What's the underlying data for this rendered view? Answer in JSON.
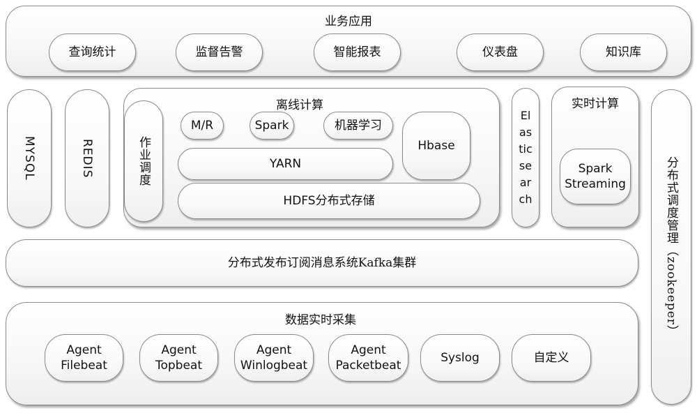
{
  "business_layer": {
    "title": "业务应用",
    "items": [
      "查询统计",
      "监督告警",
      "智能报表",
      "仪表盘",
      "知识库"
    ]
  },
  "storage": {
    "mysql": "MYSQL",
    "redis": "REDIS"
  },
  "offline_compute": {
    "title": "离线计算",
    "job_scheduling": "作业调度",
    "mr": "M/R",
    "spark": "Spark",
    "ml": "机器学习",
    "yarn": "YARN",
    "hbase": "Hbase",
    "hdfs": "HDFS分布式存储"
  },
  "elasticsearch": "El\nas\ntic\nse\nar\nch",
  "realtime_compute": {
    "title": "实时计算",
    "spark_streaming": "Spark\nStreaming"
  },
  "zookeeper": "分布式调度管理（zookeeper）",
  "kafka": "分布式发布订阅消息系统Kafka集群",
  "collection_layer": {
    "title": "数据实时采集",
    "items": [
      "Agent\nFilebeat",
      "Agent\nTopbeat",
      "Agent\nWinlogbeat",
      "Agent\nPacketbeat",
      "Syslog",
      "自定义"
    ]
  }
}
